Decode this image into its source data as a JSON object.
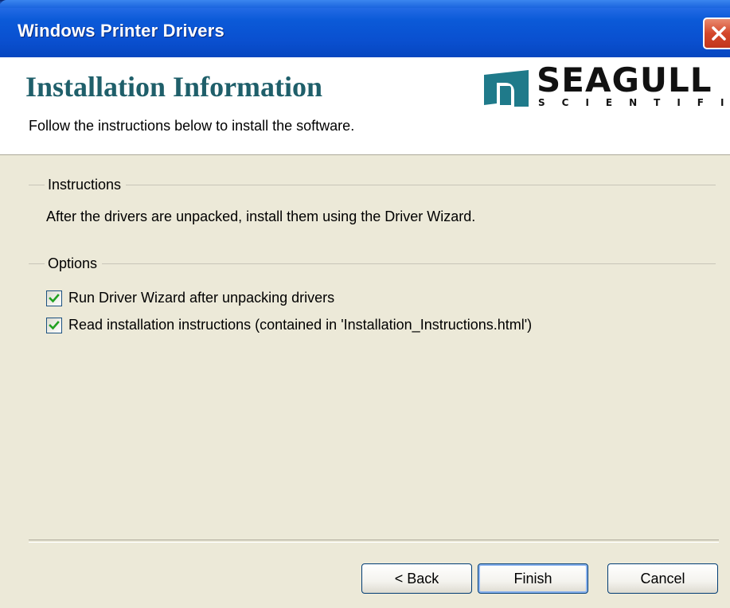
{
  "window": {
    "title": "Windows Printer Drivers"
  },
  "header": {
    "title": "Installation Information",
    "subtitle": "Follow the instructions below to install the software.",
    "logo_word": "SEAGULL",
    "logo_sub": "SCIENTIFIC"
  },
  "instructions": {
    "label": "Instructions",
    "text": "After the drivers are unpacked, install them using the Driver Wizard."
  },
  "options": {
    "label": "Options",
    "items": [
      {
        "label": "Run Driver Wizard after unpacking drivers",
        "checked": true
      },
      {
        "label": "Read installation instructions (contained in 'Installation_Instructions.html')",
        "checked": true
      }
    ]
  },
  "buttons": {
    "back": "< Back",
    "finish": "Finish",
    "cancel": "Cancel"
  },
  "colors": {
    "title_bar": "#0b5ad8",
    "header_title": "#1f5f6a",
    "close_button": "#d4472a",
    "check": "#21a121"
  },
  "icons": {
    "close": "close-icon",
    "check": "checkmark-icon",
    "logo": "seagull-logo"
  }
}
